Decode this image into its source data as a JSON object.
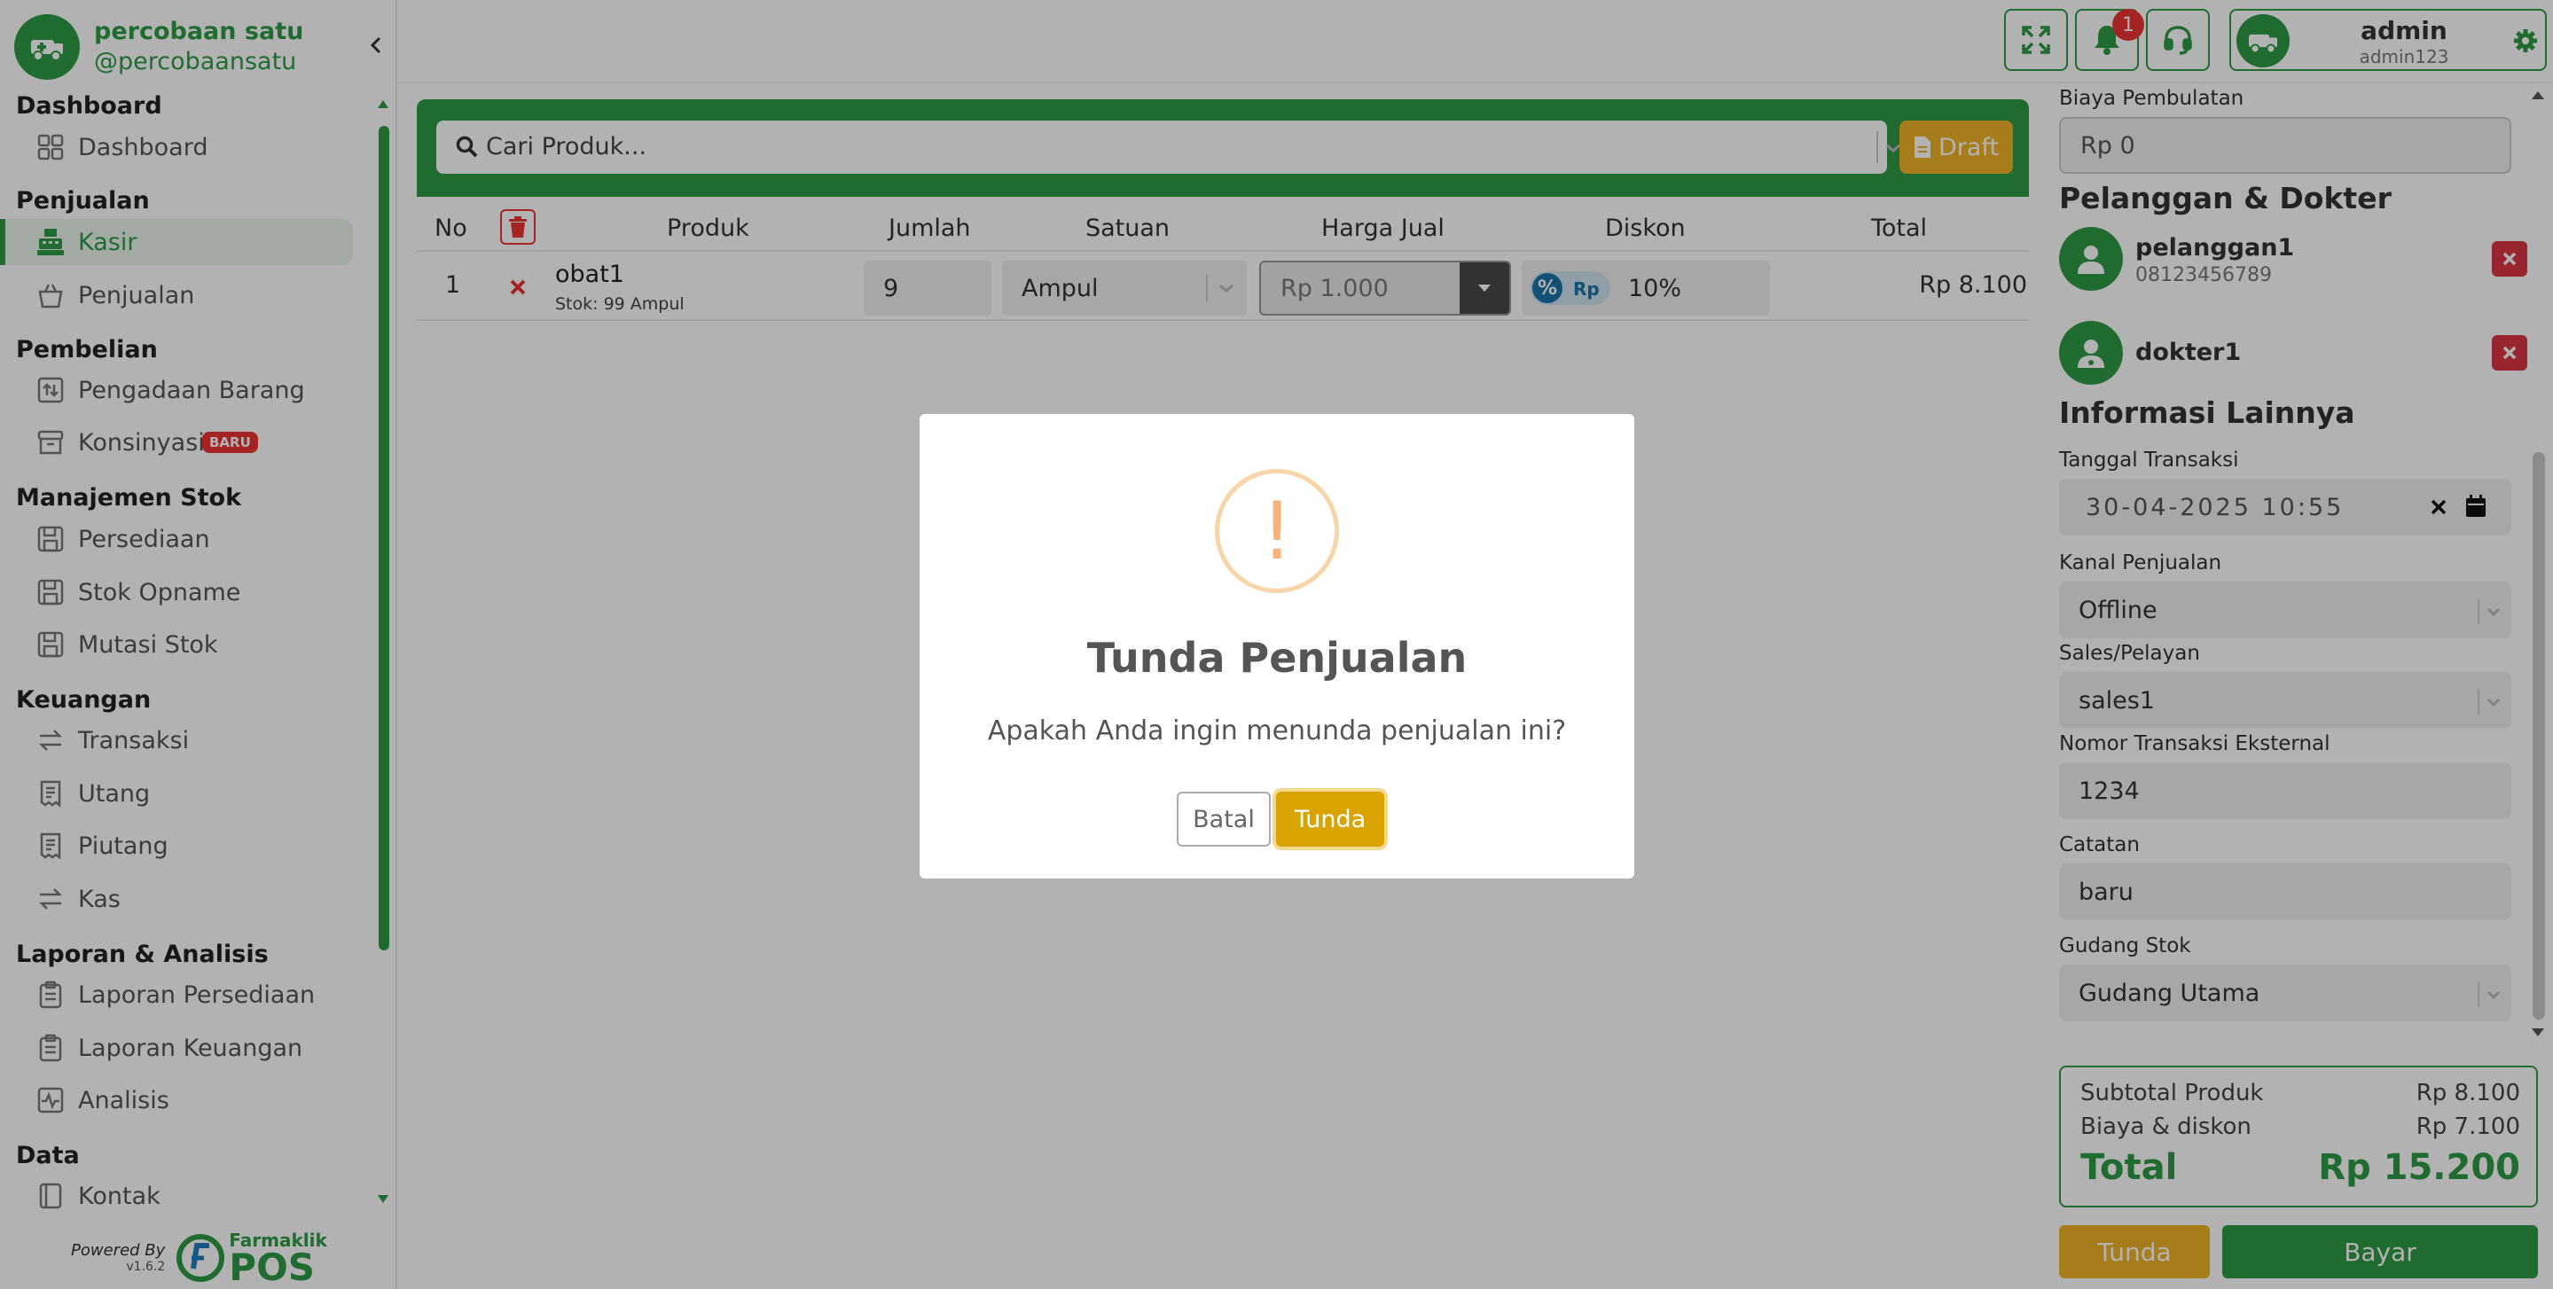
{
  "brand": {
    "name": "percobaan satu",
    "handle": "@percobaansatu"
  },
  "nav": {
    "sections": [
      {
        "title": "Dashboard",
        "items": [
          {
            "label": "Dashboard",
            "icon": "grid-icon"
          }
        ]
      },
      {
        "title": "Penjualan",
        "items": [
          {
            "label": "Kasir",
            "icon": "cash-register-icon",
            "active": true
          },
          {
            "label": "Penjualan",
            "icon": "basket-icon"
          }
        ]
      },
      {
        "title": "Pembelian",
        "items": [
          {
            "label": "Pengadaan Barang",
            "icon": "procurement-icon"
          },
          {
            "label": "Konsinyasi",
            "icon": "archive-icon",
            "badge": "BARU"
          }
        ]
      },
      {
        "title": "Manajemen Stok",
        "items": [
          {
            "label": "Persediaan",
            "icon": "save-icon"
          },
          {
            "label": "Stok Opname",
            "icon": "save-icon"
          },
          {
            "label": "Mutasi Stok",
            "icon": "save-icon"
          }
        ]
      },
      {
        "title": "Keuangan",
        "items": [
          {
            "label": "Transaksi",
            "icon": "exchange-icon"
          },
          {
            "label": "Utang",
            "icon": "receipt-icon"
          },
          {
            "label": "Piutang",
            "icon": "receipt-icon"
          },
          {
            "label": "Kas",
            "icon": "exchange-icon"
          }
        ]
      },
      {
        "title": "Laporan & Analisis",
        "items": [
          {
            "label": "Laporan Persediaan",
            "icon": "clipboard-icon"
          },
          {
            "label": "Laporan Keuangan",
            "icon": "clipboard-icon"
          },
          {
            "label": "Analisis",
            "icon": "pulse-icon"
          }
        ]
      },
      {
        "title": "Data",
        "items": [
          {
            "label": "Kontak",
            "icon": "contact-book-icon"
          }
        ]
      }
    ]
  },
  "powered": {
    "label": "Powered By",
    "version": "v1.6.2",
    "brand_top": "Farmaklik",
    "brand_bottom": "POS"
  },
  "topbar": {
    "notif_count": "1",
    "user_name": "admin",
    "user_id": "admin123"
  },
  "search": {
    "placeholder": "Cari Produk...",
    "draft_label": "Draft"
  },
  "table": {
    "headers": {
      "no": "No",
      "produk": "Produk",
      "jumlah": "Jumlah",
      "satuan": "Satuan",
      "harga": "Harga Jual",
      "diskon": "Diskon",
      "total": "Total"
    },
    "rows": [
      {
        "no": "1",
        "name": "obat1",
        "stock": "Stok: 99 Ampul",
        "qty": "9",
        "unit": "Ampul",
        "price": "Rp 1.000",
        "discount_pct": "%",
        "discount_rp": "Rp",
        "discount": "10%",
        "total": "Rp 8.100"
      }
    ]
  },
  "right": {
    "biaya_label": "Biaya Pembulatan",
    "biaya_value": "Rp 0",
    "pd_title": "Pelanggan & Dokter",
    "customer_name": "pelanggan1",
    "customer_phone": "08123456789",
    "doctor_name": "dokter1",
    "info_title": "Informasi Lainnya",
    "tanggal_label": "Tanggal Transaksi",
    "tanggal_value": "30-04-2025 10:55",
    "kanal_label": "Kanal Penjualan",
    "kanal_value": "Offline",
    "sales_label": "Sales/Pelayan",
    "sales_value": "sales1",
    "nomor_label": "Nomor Transaksi Eksternal",
    "nomor_value": "1234",
    "catatan_label": "Catatan",
    "catatan_value": "baru",
    "gudang_label": "Gudang Stok",
    "gudang_value": "Gudang Utama"
  },
  "summary": {
    "subtotal_label": "Subtotal Produk",
    "subtotal_value": "Rp 8.100",
    "biaya_label": "Biaya & diskon",
    "biaya_value": "Rp 7.100",
    "total_label": "Total",
    "total_value": "Rp 15.200"
  },
  "actions": {
    "tunda": "Tunda",
    "bayar": "Bayar"
  },
  "modal": {
    "icon": "!",
    "title": "Tunda Penjualan",
    "text": "Apakah Anda ingin menunda penjualan ini?",
    "cancel": "Batal",
    "confirm": "Tunda"
  },
  "colors": {
    "brand": "#2e9b46",
    "warning": "#f0b429",
    "danger": "#dc3545"
  }
}
